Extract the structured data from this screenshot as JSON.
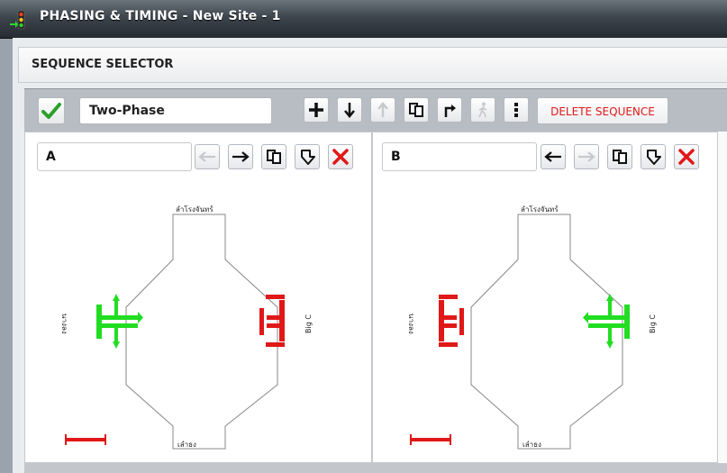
{
  "window": {
    "title": "PHASING & TIMING - New Site - 1"
  },
  "section": {
    "title": "SEQUENCE SELECTOR"
  },
  "sequence": {
    "name": "Two-Phase",
    "delete_label": "DELETE SEQUENCE"
  },
  "phases": [
    {
      "name": "A",
      "roads": {
        "north": "ลำโรงจันทร์",
        "south": "เลำธง",
        "west": "นางลง",
        "east": "Big C"
      },
      "signals": {
        "west": "green",
        "east": "red"
      }
    },
    {
      "name": "B",
      "roads": {
        "north": "ลำโรงจันทร์",
        "south": "เลำธง",
        "west": "นางลง",
        "east": "Big C"
      },
      "signals": {
        "west": "red",
        "east": "green"
      }
    }
  ],
  "colors": {
    "green": "#22dd22",
    "red": "#e01818",
    "accent_check": "#2aa02a"
  }
}
